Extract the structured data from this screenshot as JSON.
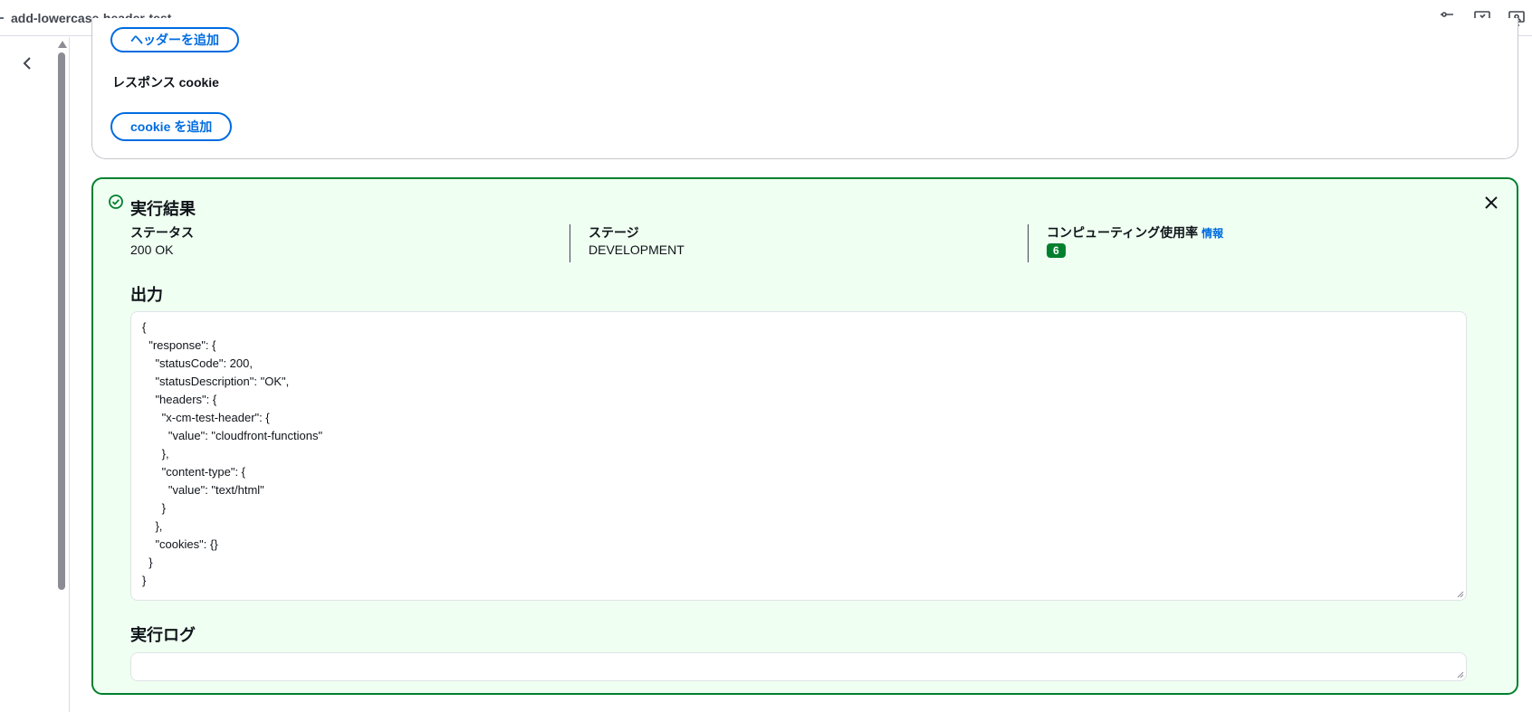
{
  "topbar": {
    "title": "add-lowercase-header-test",
    "icons": [
      "split-view-icon",
      "feedback-icon",
      "preview-icon"
    ]
  },
  "sidebar": {
    "collapse_icon": "chevron-left-icon"
  },
  "response_settings": {
    "add_header_button": "ヘッダーを追加",
    "cookie_label": "レスポンス cookie",
    "add_cookie_button": "cookie を追加"
  },
  "result": {
    "status_icon": "check-circle-icon",
    "heading": "実行結果",
    "status_label": "ステータス",
    "status_value": "200 OK",
    "stage_label": "ステージ",
    "stage_value": "DEVELOPMENT",
    "compute_label": "コンピューティング使用率",
    "info_link": "情報",
    "compute_value": "6",
    "output_heading": "出力",
    "output_text": "{\n  \"response\": {\n    \"statusCode\": 200,\n    \"statusDescription\": \"OK\",\n    \"headers\": {\n      \"x-cm-test-header\": {\n        \"value\": \"cloudfront-functions\"\n      },\n      \"content-type\": {\n        \"value\": \"text/html\"\n      }\n    },\n    \"cookies\": {}\n  }\n}",
    "log_heading": "実行ログ",
    "log_text": "",
    "colors": {
      "success": "#00802f",
      "success_bg": "#effff1",
      "link": "#006ce0"
    }
  }
}
